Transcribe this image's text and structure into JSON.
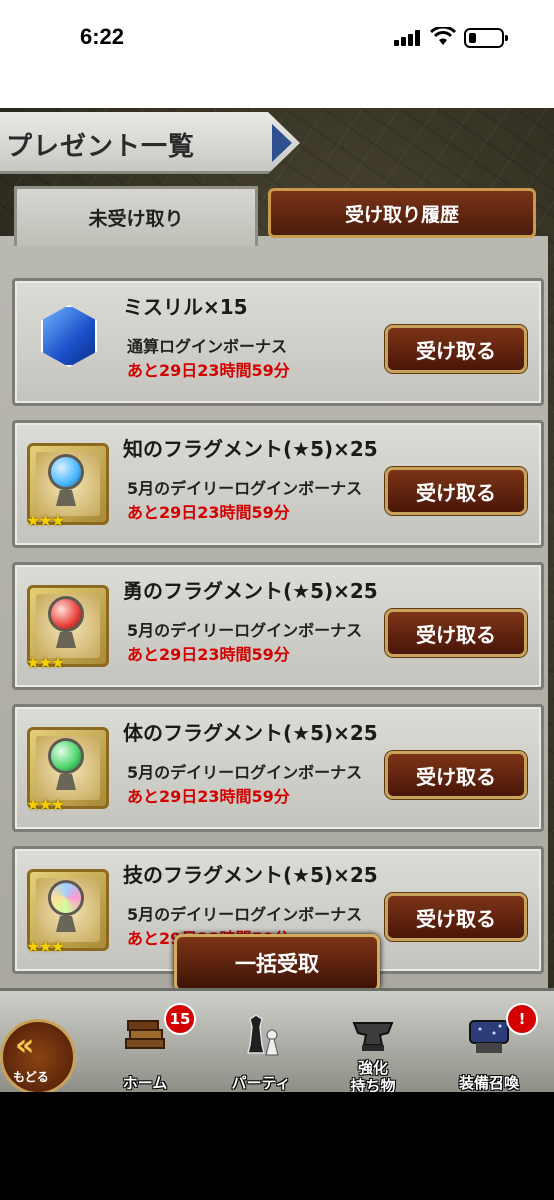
{
  "statusbar": {
    "time": "6:22"
  },
  "header": {
    "title": "プレゼント一覧"
  },
  "tabs": [
    {
      "label": "未受け取り",
      "active": true
    },
    {
      "label": "受け取り履歴",
      "active": false
    }
  ],
  "items": [
    {
      "name": "ミスリル×15",
      "desc": "通算ログインボーナス",
      "time": "あと29日23時間59分",
      "button": "受け取る",
      "icon": "mithril-crystal-icon",
      "orb_color": ""
    },
    {
      "name": "知のフラグメント(★5)×25",
      "desc": "5月のデイリーログインボーナス",
      "time": "あと29日23時間59分",
      "button": "受け取る",
      "icon": "blue-orb-icon",
      "orb_color": "#49b6ff",
      "stars": "★★★"
    },
    {
      "name": "勇のフラグメント(★5)×25",
      "desc": "5月のデイリーログインボーナス",
      "time": "あと29日23時間59分",
      "button": "受け取る",
      "icon": "red-orb-icon",
      "orb_color": "#e8403a",
      "stars": "★★★"
    },
    {
      "name": "体のフラグメント(★5)×25",
      "desc": "5月のデイリーログインボーナス",
      "time": "あと29日23時間59分",
      "button": "受け取る",
      "icon": "green-orb-icon",
      "orb_color": "#4ad26a",
      "stars": "★★★"
    },
    {
      "name": "技のフラグメント(★5)×25",
      "desc": "5月のデイリーログインボーナス",
      "time": "あと29日23時間59分",
      "button": "受け取る",
      "icon": "multicolor-orb-icon",
      "orb_color": "#9bd1ff",
      "stars": "★★★"
    }
  ],
  "bulk_button": "一括受取",
  "nav": {
    "back": {
      "chevron": "«",
      "label": "もどる"
    },
    "items": [
      {
        "label": "ホーム",
        "badge": "15",
        "icon": "books-icon"
      },
      {
        "label": "パーティ",
        "badge": "",
        "icon": "chess-pieces-icon"
      },
      {
        "label": "強化\n持ち物",
        "line1": "強化",
        "line2": "持ち物",
        "badge": "",
        "icon": "anvil-icon"
      },
      {
        "label": "装備召喚",
        "badge": "!",
        "icon": "summon-altar-icon"
      }
    ]
  }
}
